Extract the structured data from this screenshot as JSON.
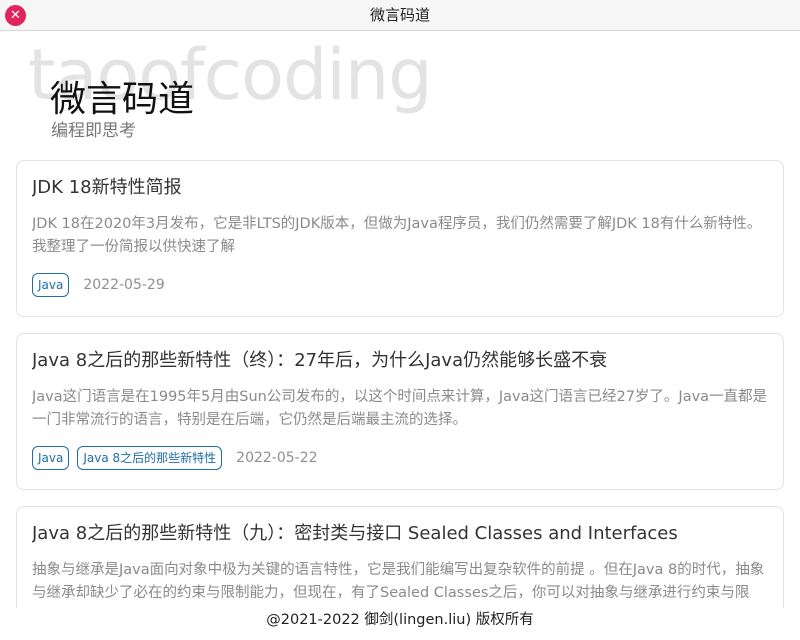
{
  "window": {
    "title": "微言码道",
    "close_glyph": "✕"
  },
  "header": {
    "watermark": "taoofcoding",
    "title": "微言码道",
    "subtitle": "编程即思考"
  },
  "posts": [
    {
      "title": "JDK 18新特性简报",
      "excerpt": "JDK 18在2020年3月发布，它是非LTS的JDK版本，但做为Java程序员，我们仍然需要了解JDK 18有什么新特性。 我整理了一份简报以供快速了解",
      "tags": [
        "Java"
      ],
      "date": "2022-05-29"
    },
    {
      "title": "Java 8之后的那些新特性（终）：27年后，为什么Java仍然能够长盛不衰",
      "excerpt": "Java这门语言是在1995年5月由Sun公司发布的，以这个时间点来计算，Java这门语言已经27岁了。Java一直都是一门非常流行的语言，特别是在后端，它仍然是后端最主流的选择。",
      "tags": [
        "Java",
        "Java 8之后的那些新特性"
      ],
      "date": "2022-05-22"
    },
    {
      "title": "Java 8之后的那些新特性（九）：密封类与接口 Sealed Classes and Interfaces",
      "excerpt": "抽象与继承是Java面向对象中极为关键的语言特性，它是我们能编写出复杂软件的前提 。但在Java 8的时代，抽象与继承却缺少了必在的约束与限制能力，但现在，有了Sealed Classes之后，你可以对抽象与继承进行约束与限"
    }
  ],
  "footer": {
    "copyright": "@2021-2022 御剑(lingen.liu) 版权所有"
  },
  "colors": {
    "close_button": "#e0245e",
    "tag_accent": "#1d6fa5",
    "watermark": "#e3e3e3"
  }
}
